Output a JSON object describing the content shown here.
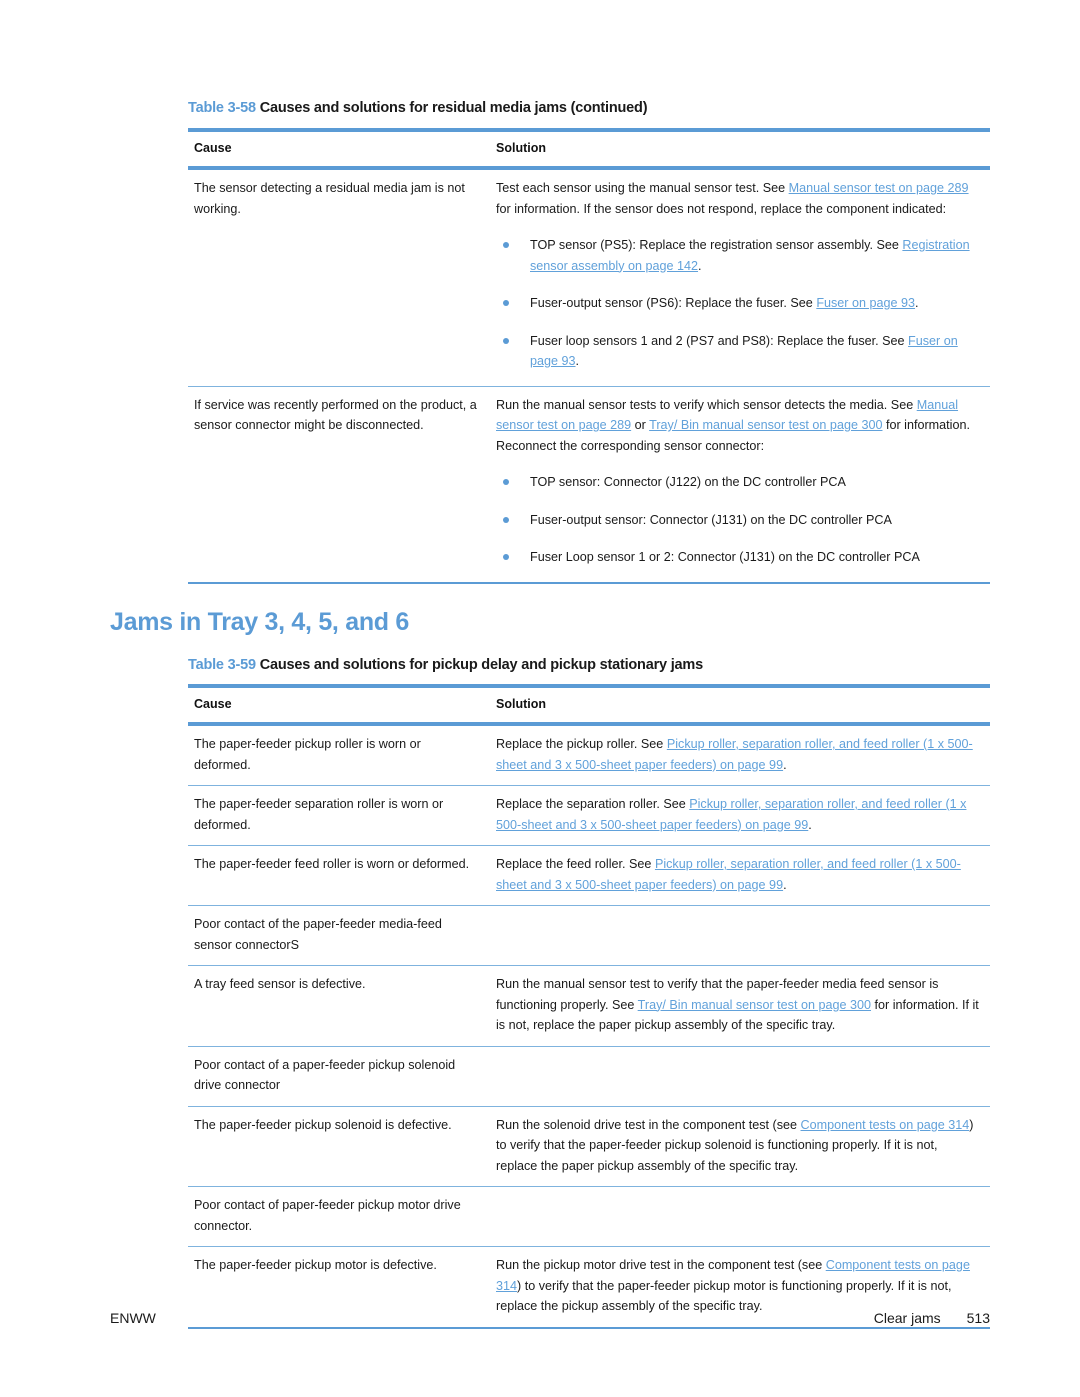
{
  "page": {
    "footer_left": "ENWW",
    "footer_section": "Clear jams",
    "footer_page": "513"
  },
  "table_58": {
    "caption_number": "Table 3-58",
    "caption_text": "Causes and solutions for residual media jams (continued)",
    "headers": {
      "cause": "Cause",
      "solution": "Solution"
    },
    "rows": [
      {
        "cause": "The sensor detecting a residual media jam is not working.",
        "solution_pre": "Test each sensor using the manual sensor test. See ",
        "solution_link1": "Manual sensor test on page 289",
        "solution_post": " for information. If the sensor does not respond, replace the component indicated:",
        "bullets": [
          {
            "pre": "TOP sensor (PS5): Replace the registration sensor assembly. See ",
            "link": "Registration sensor assembly on page 142",
            "post": "."
          },
          {
            "pre": "Fuser-output sensor (PS6): Replace the fuser. See ",
            "link": "Fuser on page 93",
            "post": "."
          },
          {
            "pre": "Fuser loop sensors 1 and 2 (PS7 and PS8): Replace the fuser. See ",
            "link": "Fuser on page 93",
            "post": "."
          }
        ]
      },
      {
        "cause": "If service was recently performed on the product, a sensor connector might be disconnected.",
        "solution_pre": "Run the manual sensor tests to verify which sensor detects the media. See ",
        "solution_link1": "Manual sensor test on page 289",
        "solution_mid": " or ",
        "solution_link2": "Tray/ Bin manual sensor test on page 300",
        "solution_post": " for information. Reconnect the corresponding sensor connector:",
        "bullets": [
          {
            "pre": "TOP sensor: Connector (J122) on the DC controller PCA",
            "link": "",
            "post": ""
          },
          {
            "pre": "Fuser-output sensor: Connector (J131) on the DC controller PCA",
            "link": "",
            "post": ""
          },
          {
            "pre": "Fuser Loop sensor 1 or 2: Connector (J131) on the DC controller PCA",
            "link": "",
            "post": ""
          }
        ]
      }
    ]
  },
  "section_heading": "Jams in Tray 3, 4, 5, and 6",
  "table_59": {
    "caption_number": "Table 3-59",
    "caption_text": "Causes and solutions for pickup delay and pickup stationary jams",
    "headers": {
      "cause": "Cause",
      "solution": "Solution"
    },
    "rows": [
      {
        "cause": "The paper-feeder pickup roller is worn or deformed.",
        "sol_pre": "Replace the pickup roller. See ",
        "sol_link": "Pickup roller, separation roller, and feed roller (1 x 500-sheet and 3 x 500-sheet paper feeders) on page 99",
        "sol_post": "."
      },
      {
        "cause": "The paper-feeder separation roller is worn or deformed.",
        "sol_pre": "Replace the separation roller. See ",
        "sol_link": "Pickup roller, separation roller, and feed roller (1 x 500-sheet and 3 x 500-sheet paper feeders) on page 99",
        "sol_post": "."
      },
      {
        "cause": "The paper-feeder feed roller is worn or deformed.",
        "sol_pre": "Replace the feed roller. See ",
        "sol_link": "Pickup roller, separation roller, and feed roller (1 x 500-sheet and 3 x 500-sheet paper feeders) on page 99",
        "sol_post": "."
      },
      {
        "cause": "Poor contact of the paper-feeder media-feed sensor connectorS",
        "sol_pre": "",
        "sol_link": "",
        "sol_post": ""
      },
      {
        "cause": "A tray feed sensor is defective.",
        "sol_pre": "Run the manual sensor test to verify that the paper-feeder media feed sensor is functioning properly. See ",
        "sol_link": "Tray/ Bin manual sensor test on page 300",
        "sol_post": " for information. If it is not, replace the paper pickup assembly of the specific tray."
      },
      {
        "cause": "Poor contact of a paper-feeder pickup solenoid drive connector",
        "sol_pre": "",
        "sol_link": "",
        "sol_post": ""
      },
      {
        "cause": "The paper-feeder pickup solenoid is defective.",
        "sol_pre": "Run the solenoid drive test in the component test (see ",
        "sol_link": "Component tests on page 314",
        "sol_post": ") to verify that the paper-feeder pickup solenoid is functioning properly. If it is not, replace the paper pickup assembly of the specific tray."
      },
      {
        "cause": "Poor contact of paper-feeder pickup motor drive connector.",
        "sol_pre": "",
        "sol_link": "",
        "sol_post": ""
      },
      {
        "cause": "The paper-feeder pickup motor is defective.",
        "sol_pre": "Run the pickup motor drive test in the component test (see ",
        "sol_link": "Component tests on page 314",
        "sol_post": ") to verify that the paper-feeder pickup motor is functioning properly. If it is not, replace the pickup assembly of the specific tray."
      }
    ]
  },
  "colors": {
    "accent_blue": "#5b9bd5",
    "link_blue": "#61a1da",
    "rule_blue": "#7fb3de",
    "text": "#1a1a1a"
  }
}
